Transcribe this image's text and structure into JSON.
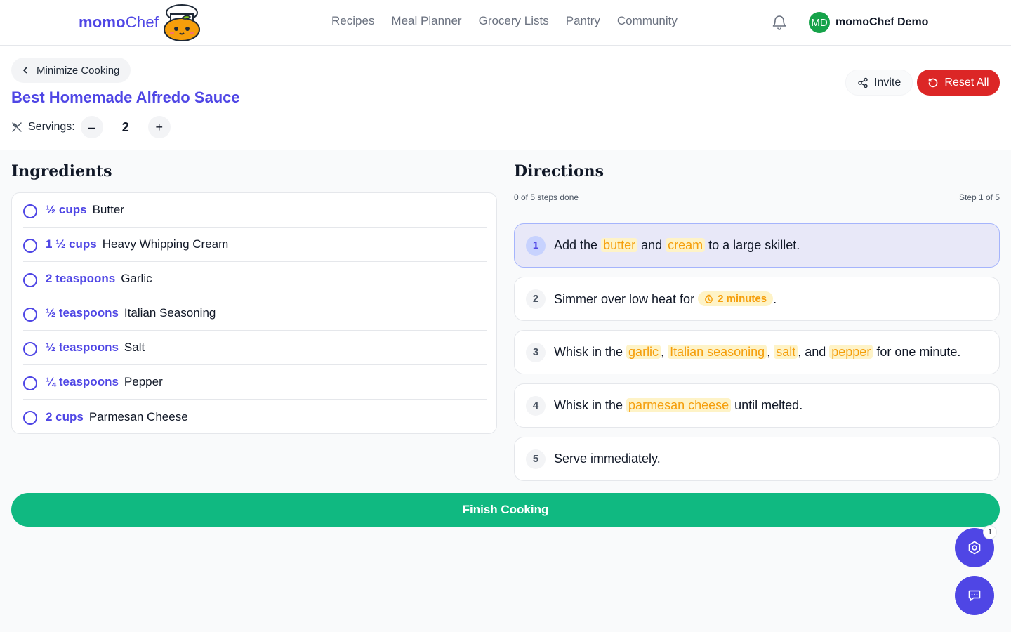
{
  "nav": {
    "logo_bold": "momo",
    "logo_light": "Chef",
    "links": [
      "Recipes",
      "Meal Planner",
      "Grocery Lists",
      "Pantry",
      "Community"
    ],
    "user_initials": "MD",
    "user_name": "momoChef Demo"
  },
  "header": {
    "back_label": "Minimize Cooking",
    "recipe_title": "Best Homemade Alfredo Sauce",
    "servings_label": "Servings:",
    "servings_value": "2",
    "invite_label": "Invite",
    "reset_label": "Reset All"
  },
  "ingredients": {
    "title": "Ingredients",
    "items": [
      {
        "qty": "½ cups",
        "name": "Butter"
      },
      {
        "qty": "1 ½ cups",
        "name": "Heavy Whipping Cream"
      },
      {
        "qty": "2 teaspoons",
        "name": "Garlic"
      },
      {
        "qty": "½ teaspoons",
        "name": "Italian Seasoning"
      },
      {
        "qty": "½ teaspoons",
        "name": "Salt"
      },
      {
        "qty": "¼ teaspoons",
        "name": "Pepper"
      },
      {
        "qty": "2 cups",
        "name": "Parmesan Cheese"
      }
    ]
  },
  "directions": {
    "title": "Directions",
    "progress": "0 of 5 steps done",
    "step_indicator": "Step 1 of 5",
    "steps": [
      {
        "num": "1",
        "parts": [
          "Add the ",
          "butter",
          " and ",
          "cream",
          " to a large skillet."
        ]
      },
      {
        "num": "2",
        "parts": [
          "Simmer over low heat for ",
          "2 minutes",
          "."
        ]
      },
      {
        "num": "3",
        "parts": [
          "Whisk in the ",
          "garlic",
          ", ",
          "Italian seasoning",
          ", ",
          "salt",
          ", and ",
          "pepper",
          " for one minute."
        ]
      },
      {
        "num": "4",
        "parts": [
          "Whisk in the ",
          "parmesan cheese",
          " until melted."
        ]
      },
      {
        "num": "5",
        "parts": [
          "Serve immediately."
        ]
      }
    ]
  },
  "finish_label": "Finish Cooking",
  "fab": {
    "badge_count": "1"
  },
  "colors": {
    "brand": "#4f46e5",
    "danger": "#dc2626",
    "success": "#10b981",
    "highlight": "#f59e0b"
  }
}
